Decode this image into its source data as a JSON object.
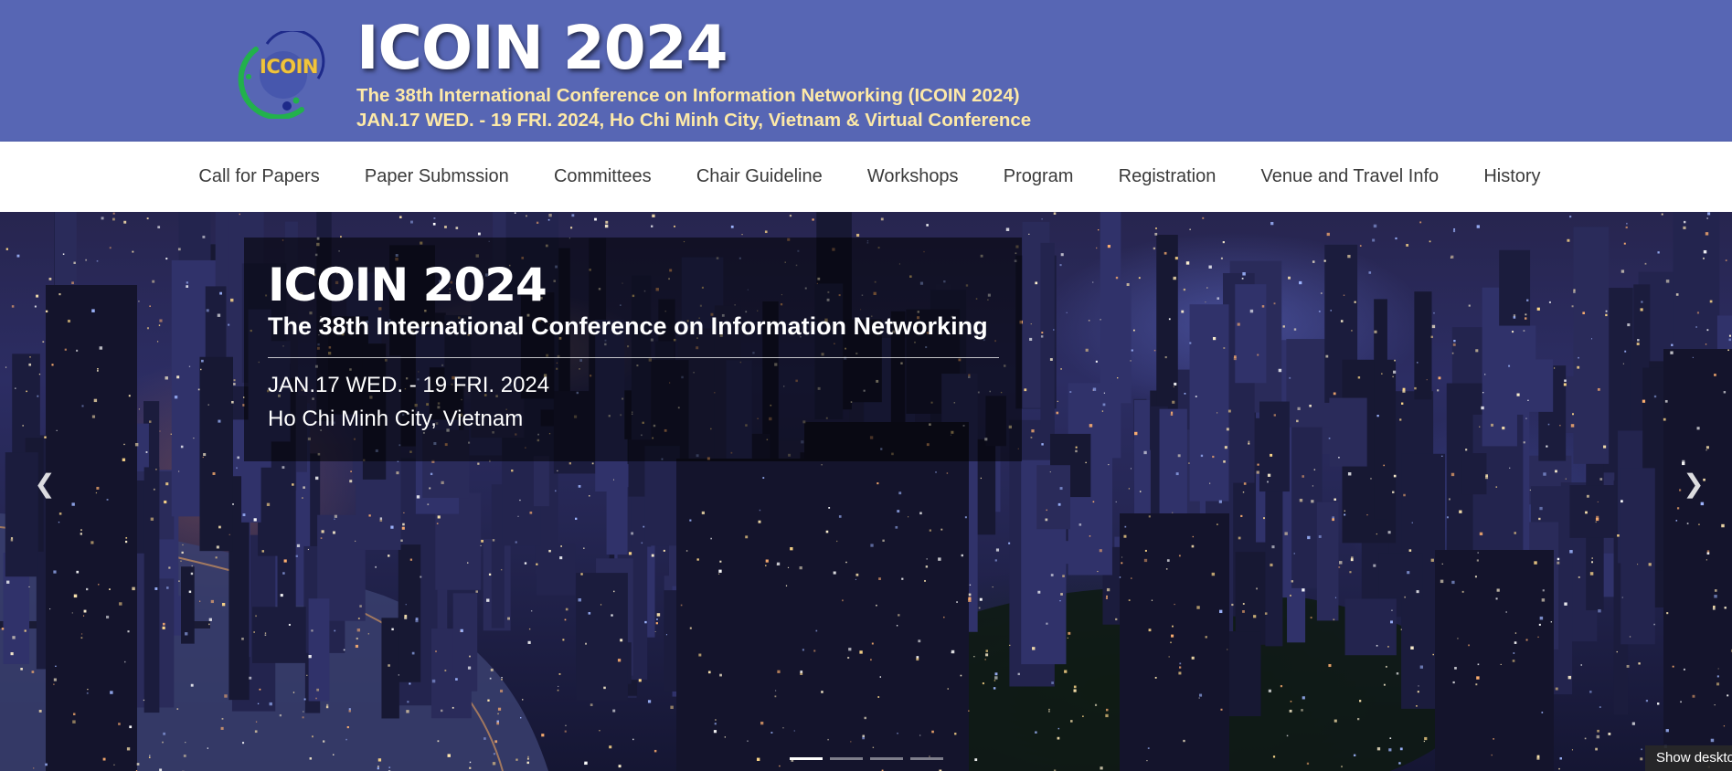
{
  "header": {
    "logo_text": "ICOIN",
    "title": "ICOIN 2024",
    "subtitle": "The 38th International Conference on Information Networking (ICOIN 2024)",
    "dates": "JAN.17 WED. - 19 FRI. 2024, Ho Chi Minh City, Vietnam & Virtual Conference",
    "background_color": "#5766b4",
    "subtitle_color": "#fde9a8"
  },
  "nav": {
    "items": [
      {
        "label": "Call for Papers"
      },
      {
        "label": "Paper Submssion"
      },
      {
        "label": "Committees"
      },
      {
        "label": "Chair Guideline"
      },
      {
        "label": "Workshops"
      },
      {
        "label": "Program"
      },
      {
        "label": "Registration"
      },
      {
        "label": "Venue and Travel Info"
      },
      {
        "label": "History"
      }
    ]
  },
  "hero": {
    "caption": {
      "title": "ICOIN 2024",
      "subtitle": "The 38th International Conference on Information Networking",
      "date": "JAN.17 WED. - 19 FRI. 2024",
      "place": "Ho Chi Minh City, Vietnam"
    },
    "prev_icon": "chevron-left-icon",
    "next_icon": "chevron-right-icon",
    "slides_count": 4,
    "active_slide": 1,
    "show_desktop_label": "Show desktop"
  }
}
